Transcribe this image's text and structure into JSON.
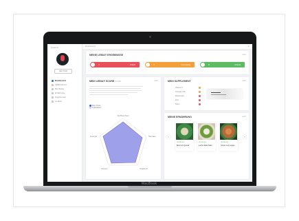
{
  "app": {
    "logo": "Gesund",
    "user_button": "Mein Profil",
    "breadcrumb": "Dashboard",
    "device_brand": "MacBook"
  },
  "sidebar": {
    "items": [
      {
        "label": "Dashboard",
        "active": true
      },
      {
        "label": "LEBIA Score",
        "active": false
      },
      {
        "label": "Bio Werte",
        "active": false
      },
      {
        "label": "Ernährung",
        "active": false
      },
      {
        "label": "Supplement",
        "active": false
      },
      {
        "label": "Lexikon",
        "active": false
      }
    ]
  },
  "goals": {
    "title": "MEINE LEBIA® ERGEBNISSE",
    "more": "mehr",
    "items": [
      {
        "value": "3",
        "label": "Kritisch",
        "color": "#e8515a"
      },
      {
        "value": "5",
        "label": "Grenzwertig",
        "color": "#f4a03a"
      },
      {
        "value": "8",
        "label": "Optimal",
        "color": "#5dbb63"
      }
    ]
  },
  "score": {
    "title": "MEIN LEBIA® SCORE",
    "subtitle": "03.2021",
    "more": "mehr",
    "legend": [
      {
        "label": "Mein Score",
        "color": "#3b5bd6"
      },
      {
        "label": "Optimalwert",
        "color": "#c9cfe6"
      }
    ],
    "axes": [
      "Stoffwechsel",
      "Mentale",
      "Vitalstoff",
      "Fitness",
      "Energie"
    ]
  },
  "supplement": {
    "title": "MEIN SUPPLEMENT",
    "more": "mehr",
    "rows": [
      {
        "label": "Vitamin D",
        "color": "#f4a03a"
      },
      {
        "label": "Omega-3 Öle",
        "color": "#f4a03a"
      },
      {
        "label": "Magnesium",
        "color": "#e8515a"
      },
      {
        "label": "Zink",
        "color": "#e8515a"
      },
      {
        "label": "Selen",
        "color": "#e8515a"
      }
    ]
  },
  "nutrition": {
    "title": "MEINE ERNÄHRUNG",
    "more": "mehr",
    "foods": [
      {
        "name": "Bowl mit Quinoa",
        "stars": "★★★★★",
        "color": "#3f8a45"
      },
      {
        "name": "Lachs Salat Teller",
        "stars": "★★★★★",
        "color": "#6d9c3c"
      },
      {
        "name": "Grüne Currysuppe",
        "stars": "★★★★★",
        "color": "#b26a3a"
      }
    ]
  }
}
